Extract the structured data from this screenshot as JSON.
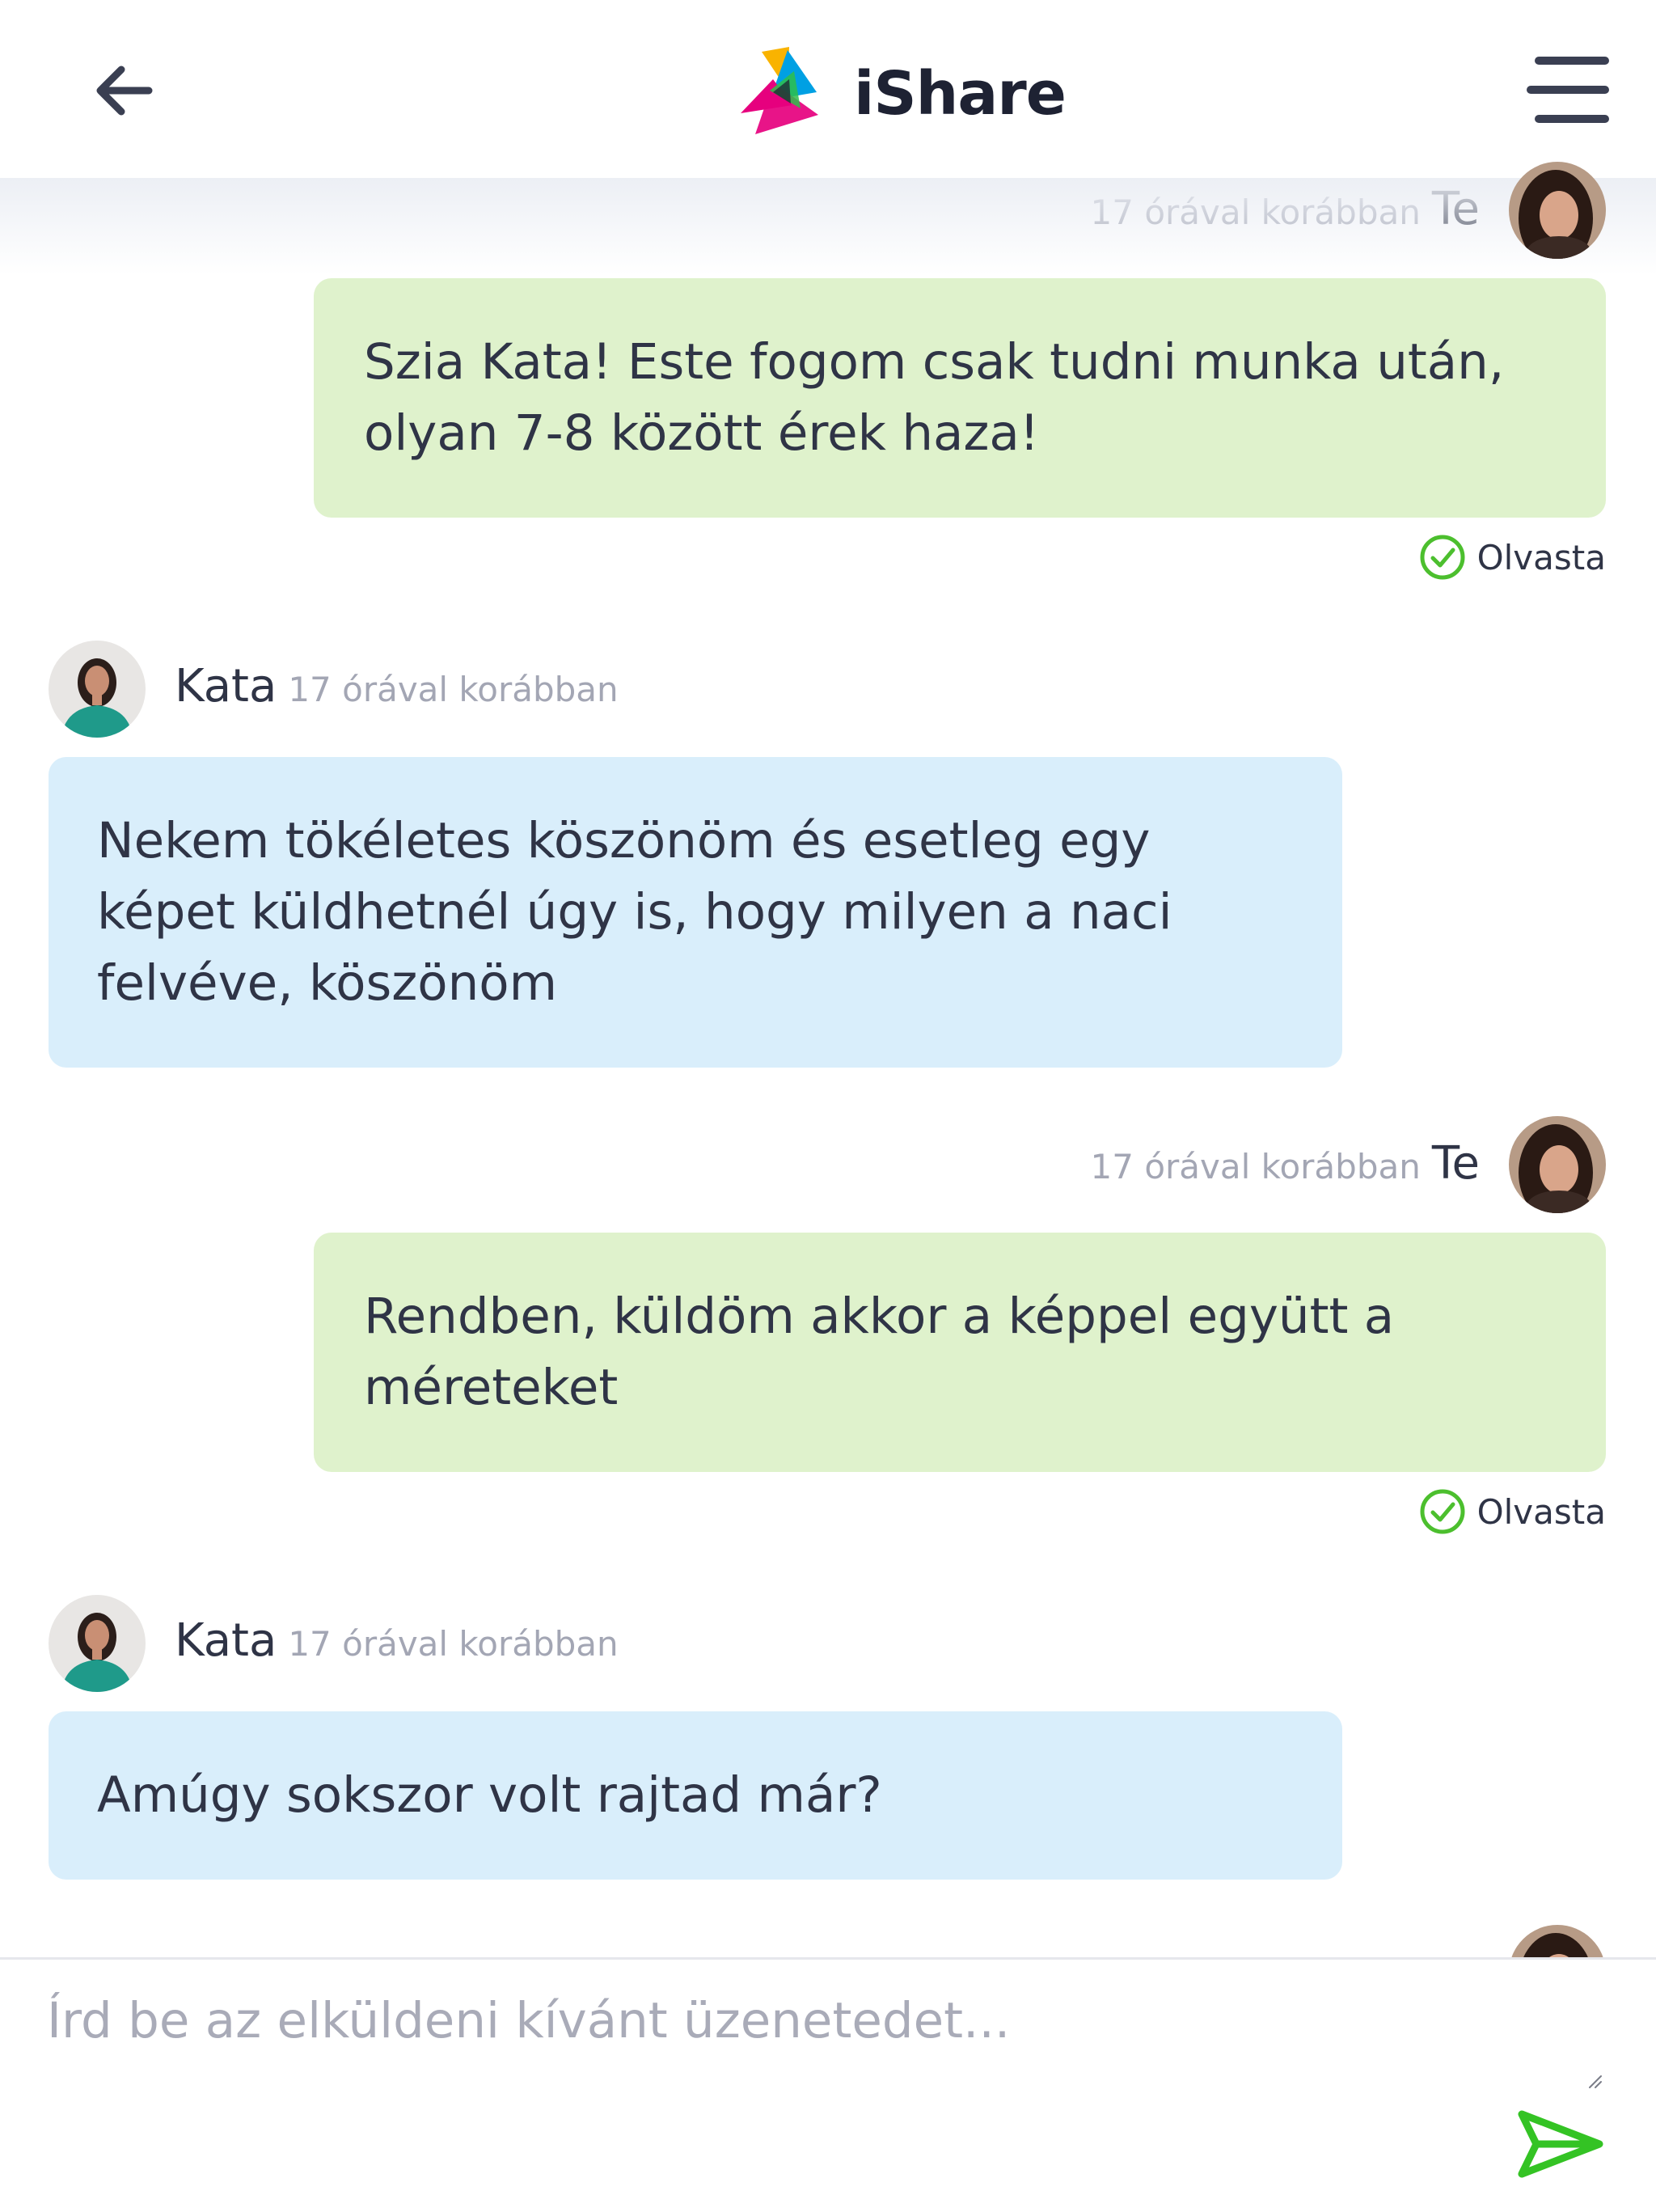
{
  "header": {
    "app_name": "iShare",
    "back_icon": "arrow-left-icon",
    "menu_icon": "hamburger-menu-icon",
    "logo_colors": [
      "#f9b300",
      "#00a0e3",
      "#e6007e",
      "#2ec04a"
    ]
  },
  "messages": [
    {
      "sender": "me",
      "name": "Te",
      "time": "17 órával korábban",
      "text": "Szia Kata! Este fogom csak tudni munka után, olyan 7-8 között érek haza!",
      "status": "Olvasta"
    },
    {
      "sender": "other",
      "name": "Kata",
      "time": "17 órával korábban",
      "text": "Nekem tökéletes köszönöm és esetleg egy képet küldhetnél úgy is, hogy milyen a naci felvéve, köszönöm"
    },
    {
      "sender": "me",
      "name": "Te",
      "time": "17 órával korábban",
      "text": "Rendben, küldöm akkor a képpel együtt a méreteket",
      "status": "Olvasta"
    },
    {
      "sender": "other",
      "name": "Kata",
      "time": "17 órával korábban",
      "text": "Amúgy sokszor volt rajtad már?"
    }
  ],
  "composer": {
    "placeholder": "Írd be az elküldeni kívánt üzenetedet...",
    "value": "",
    "send_icon": "send-icon"
  },
  "colors": {
    "bubble_me": "#dff2cc",
    "bubble_other": "#d9eefb",
    "read_check": "#4cbf2e",
    "send": "#34c324"
  }
}
